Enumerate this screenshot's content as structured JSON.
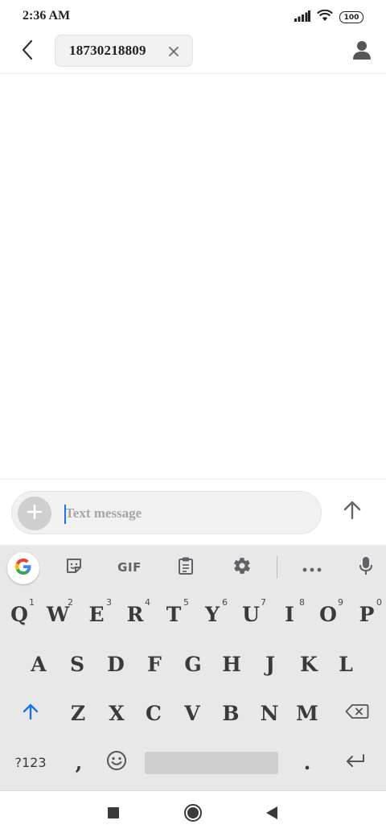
{
  "status_bar": {
    "time": "2:36 AM",
    "battery": "100",
    "icons": [
      "signal-icon",
      "wifi-icon",
      "battery-icon"
    ]
  },
  "header": {
    "recipient": "18730218809",
    "icons": [
      "back-arrow-icon",
      "close-icon",
      "person-icon"
    ]
  },
  "compose": {
    "placeholder": "Text message",
    "value": "",
    "icons": [
      "plus-icon",
      "send-arrow-icon"
    ]
  },
  "keyboard": {
    "toolbar": {
      "gif_label": "GIF",
      "icons": [
        "google-icon",
        "sticker-icon",
        "clipboard-icon",
        "settings-gear-icon",
        "more-dots-icon",
        "microphone-icon"
      ]
    },
    "row1": [
      {
        "label": "Q",
        "hint": "1"
      },
      {
        "label": "W",
        "hint": "2"
      },
      {
        "label": "E",
        "hint": "3"
      },
      {
        "label": "R",
        "hint": "4"
      },
      {
        "label": "T",
        "hint": "5"
      },
      {
        "label": "Y",
        "hint": "6"
      },
      {
        "label": "U",
        "hint": "7"
      },
      {
        "label": "I",
        "hint": "8"
      },
      {
        "label": "O",
        "hint": "9"
      },
      {
        "label": "P",
        "hint": "0"
      }
    ],
    "row2": [
      "A",
      "S",
      "D",
      "F",
      "G",
      "H",
      "J",
      "K",
      "L"
    ],
    "row3": [
      "Z",
      "X",
      "C",
      "V",
      "B",
      "N",
      "M"
    ],
    "row4": {
      "symbols": "?123",
      "comma": ",",
      "period": ".",
      "icons": [
        "emoji-icon",
        "enter-icon"
      ]
    },
    "accent_color": "#1a73e8"
  },
  "nav_bar": {
    "icons": [
      "recents-square-icon",
      "home-circle-icon",
      "back-triangle-icon"
    ]
  }
}
